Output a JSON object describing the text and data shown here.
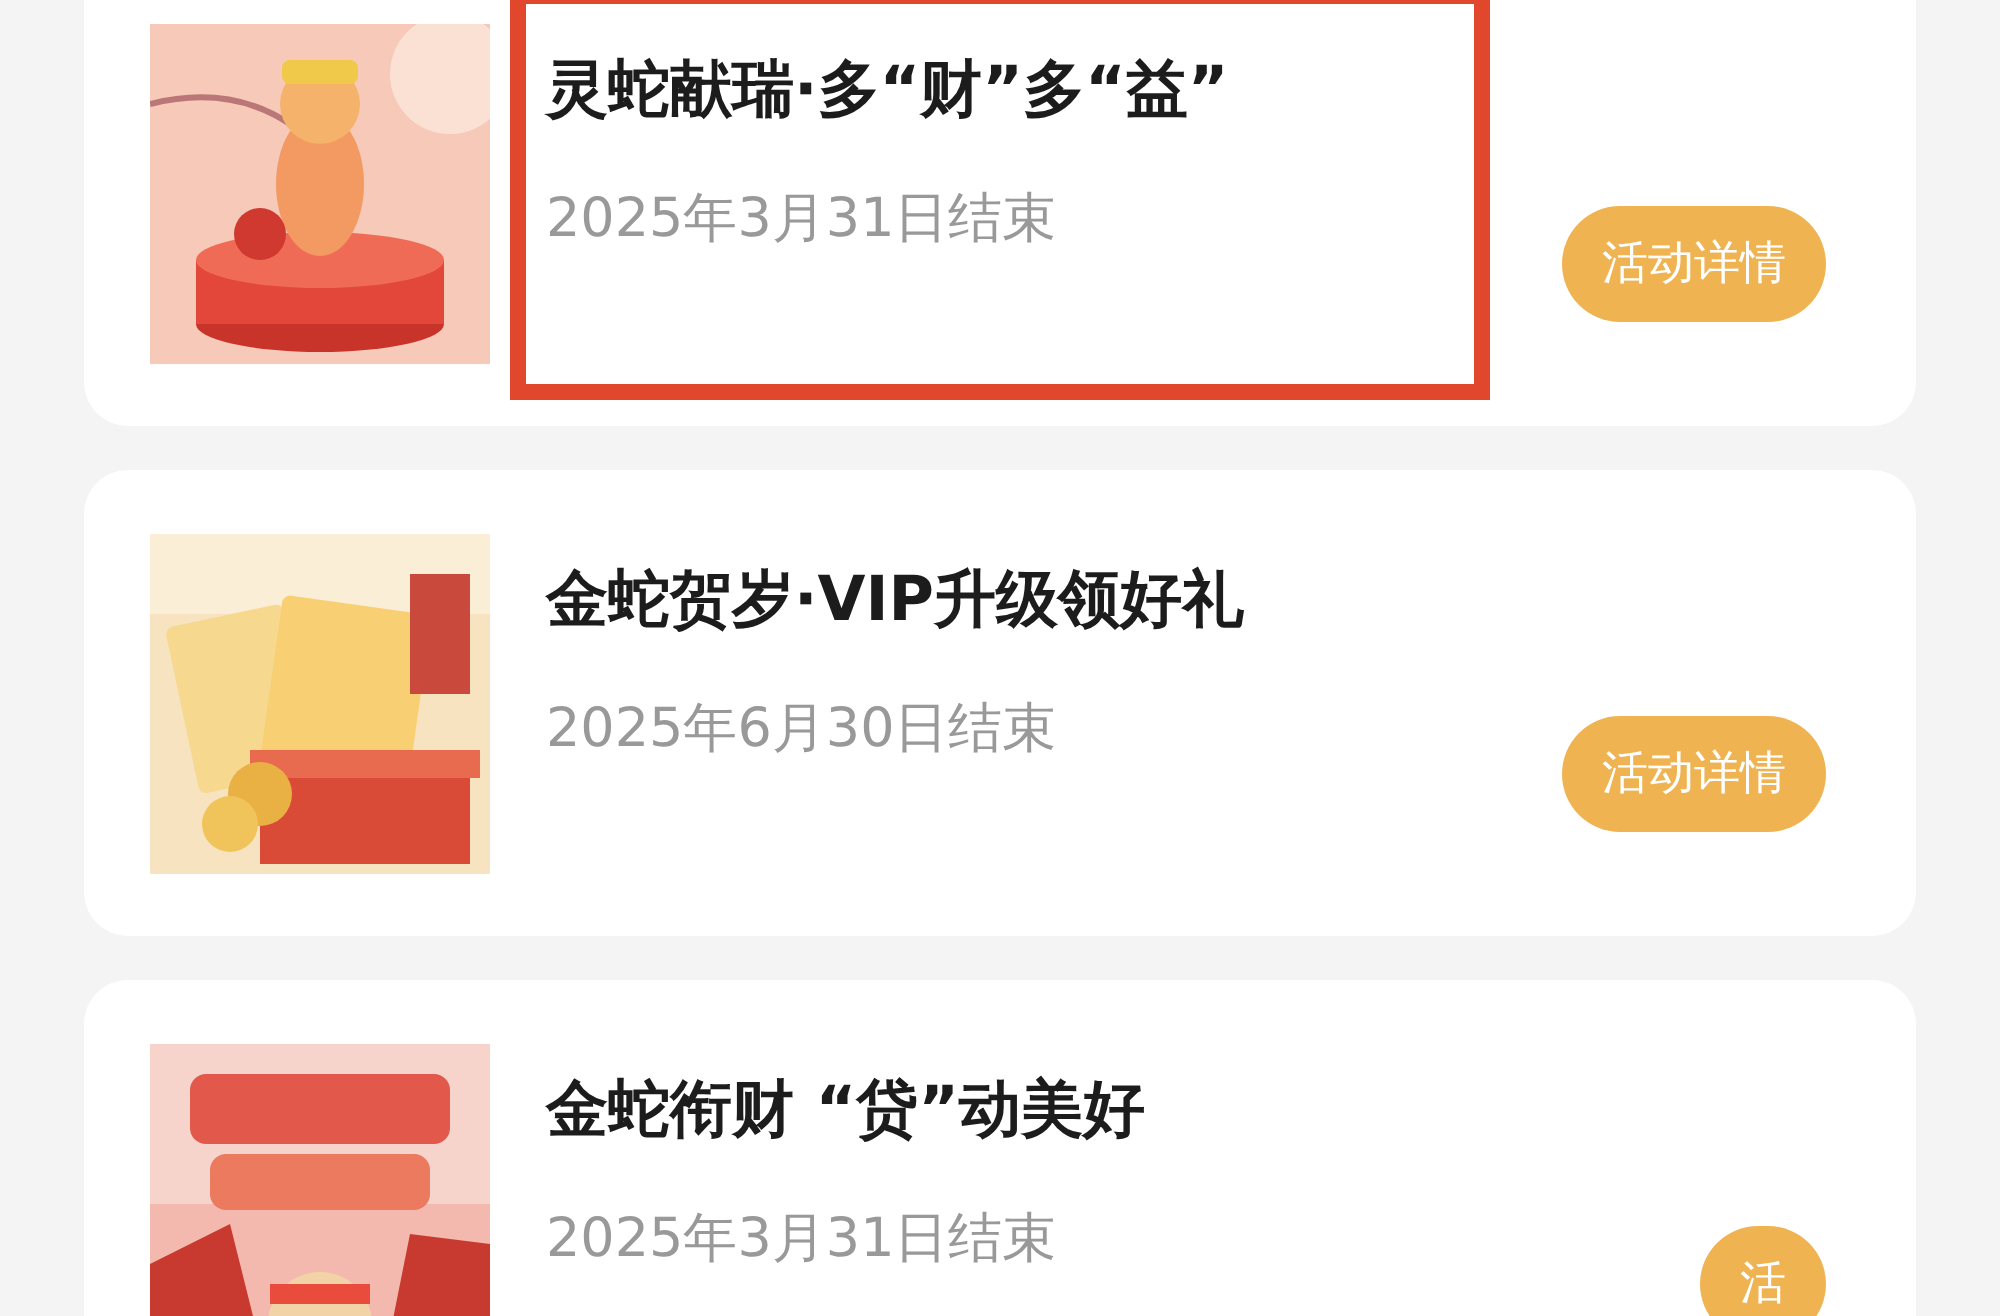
{
  "activities": [
    {
      "title": "灵蛇献瑞·多“财”多“益”",
      "end_date": "2025年3月31日结束",
      "button": "活动详情",
      "highlighted": true
    },
    {
      "title": "金蛇贺岁·VIP升级领好礼",
      "end_date": "2025年6月30日结束",
      "button": "活动详情",
      "highlighted": false
    },
    {
      "title": "金蛇衔财 “贷”动美好",
      "end_date": "2025年3月31日结束",
      "button": "活",
      "highlighted": false
    }
  ]
}
